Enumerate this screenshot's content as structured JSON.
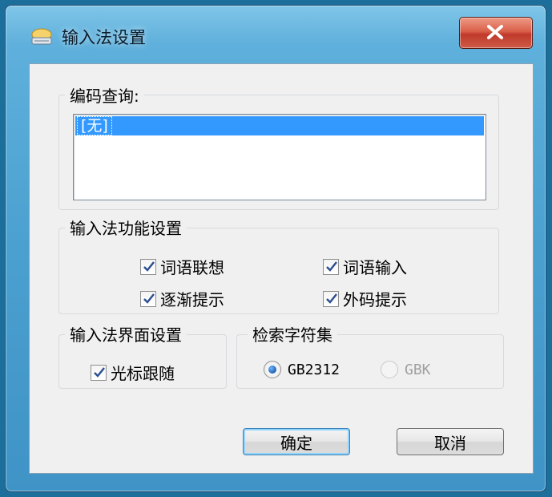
{
  "window": {
    "title": "输入法设置",
    "icon": "keyboard-ime-icon",
    "close_icon": "close-icon"
  },
  "code_query": {
    "label": "编码查询:",
    "items": [
      "[无]"
    ]
  },
  "features": {
    "label": "输入法功能设置",
    "options": [
      {
        "label": "词语联想",
        "checked": true
      },
      {
        "label": "词语输入",
        "checked": true
      },
      {
        "label": "逐渐提示",
        "checked": true
      },
      {
        "label": "外码提示",
        "checked": true
      }
    ]
  },
  "interface": {
    "label": "输入法界面设置",
    "options": [
      {
        "label": "光标跟随",
        "checked": true
      }
    ]
  },
  "charset": {
    "label": "检索字符集",
    "options": [
      {
        "label": "GB2312",
        "selected": true,
        "enabled": true
      },
      {
        "label": "GBK",
        "selected": false,
        "enabled": false
      }
    ]
  },
  "buttons": {
    "ok": "确定",
    "cancel": "取消"
  }
}
